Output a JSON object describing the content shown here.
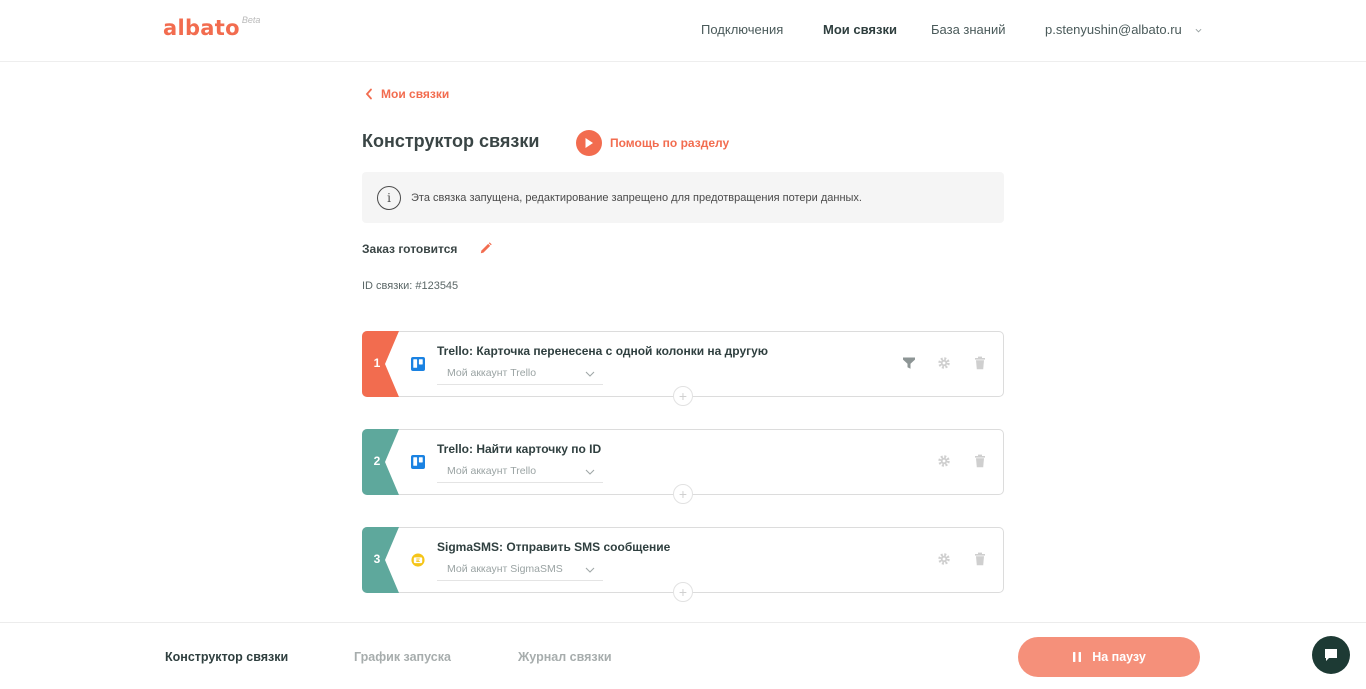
{
  "header": {
    "logo": "albato",
    "logo_badge": "Beta",
    "nav": [
      "Подключения",
      "Мои связки",
      "База знаний"
    ],
    "user_email": "p.stenyushin@albato.ru"
  },
  "content": {
    "back_link": "Мои связки",
    "title": "Конструктор связки",
    "help_label": "Помощь по разделу",
    "notice": "Эта связка запущена, редактирование запрещено для предотвращения потери данных.",
    "bundle_name": "Заказ готовится",
    "bundle_id": "ID связки: #123545"
  },
  "steps": [
    {
      "num": "1",
      "title": "Trello: Карточка перенесена с одной колонки на другую",
      "account": "Мой аккаунт Trello",
      "color": "#f26c4f",
      "app": "trello-icon",
      "filter": true
    },
    {
      "num": "2",
      "title": "Trello: Найти карточку по ID",
      "account": "Мой аккаунт Trello",
      "color": "#5ea89c",
      "app": "trello-icon",
      "filter": false
    },
    {
      "num": "3",
      "title": "SigmaSMS: Отправить SMS сообщение",
      "account": "Мой аккаунт SigmaSMS",
      "color": "#5ea89c",
      "app": "sigmasms-icon",
      "filter": false
    }
  ],
  "footer": {
    "tabs": [
      "Конструктор связки",
      "График запуска",
      "Журнал связки"
    ],
    "pause_label": "На паузу"
  },
  "colors": {
    "accent": "#f26c4f",
    "teal": "#5ea89c",
    "chat": "#1d3a34"
  }
}
